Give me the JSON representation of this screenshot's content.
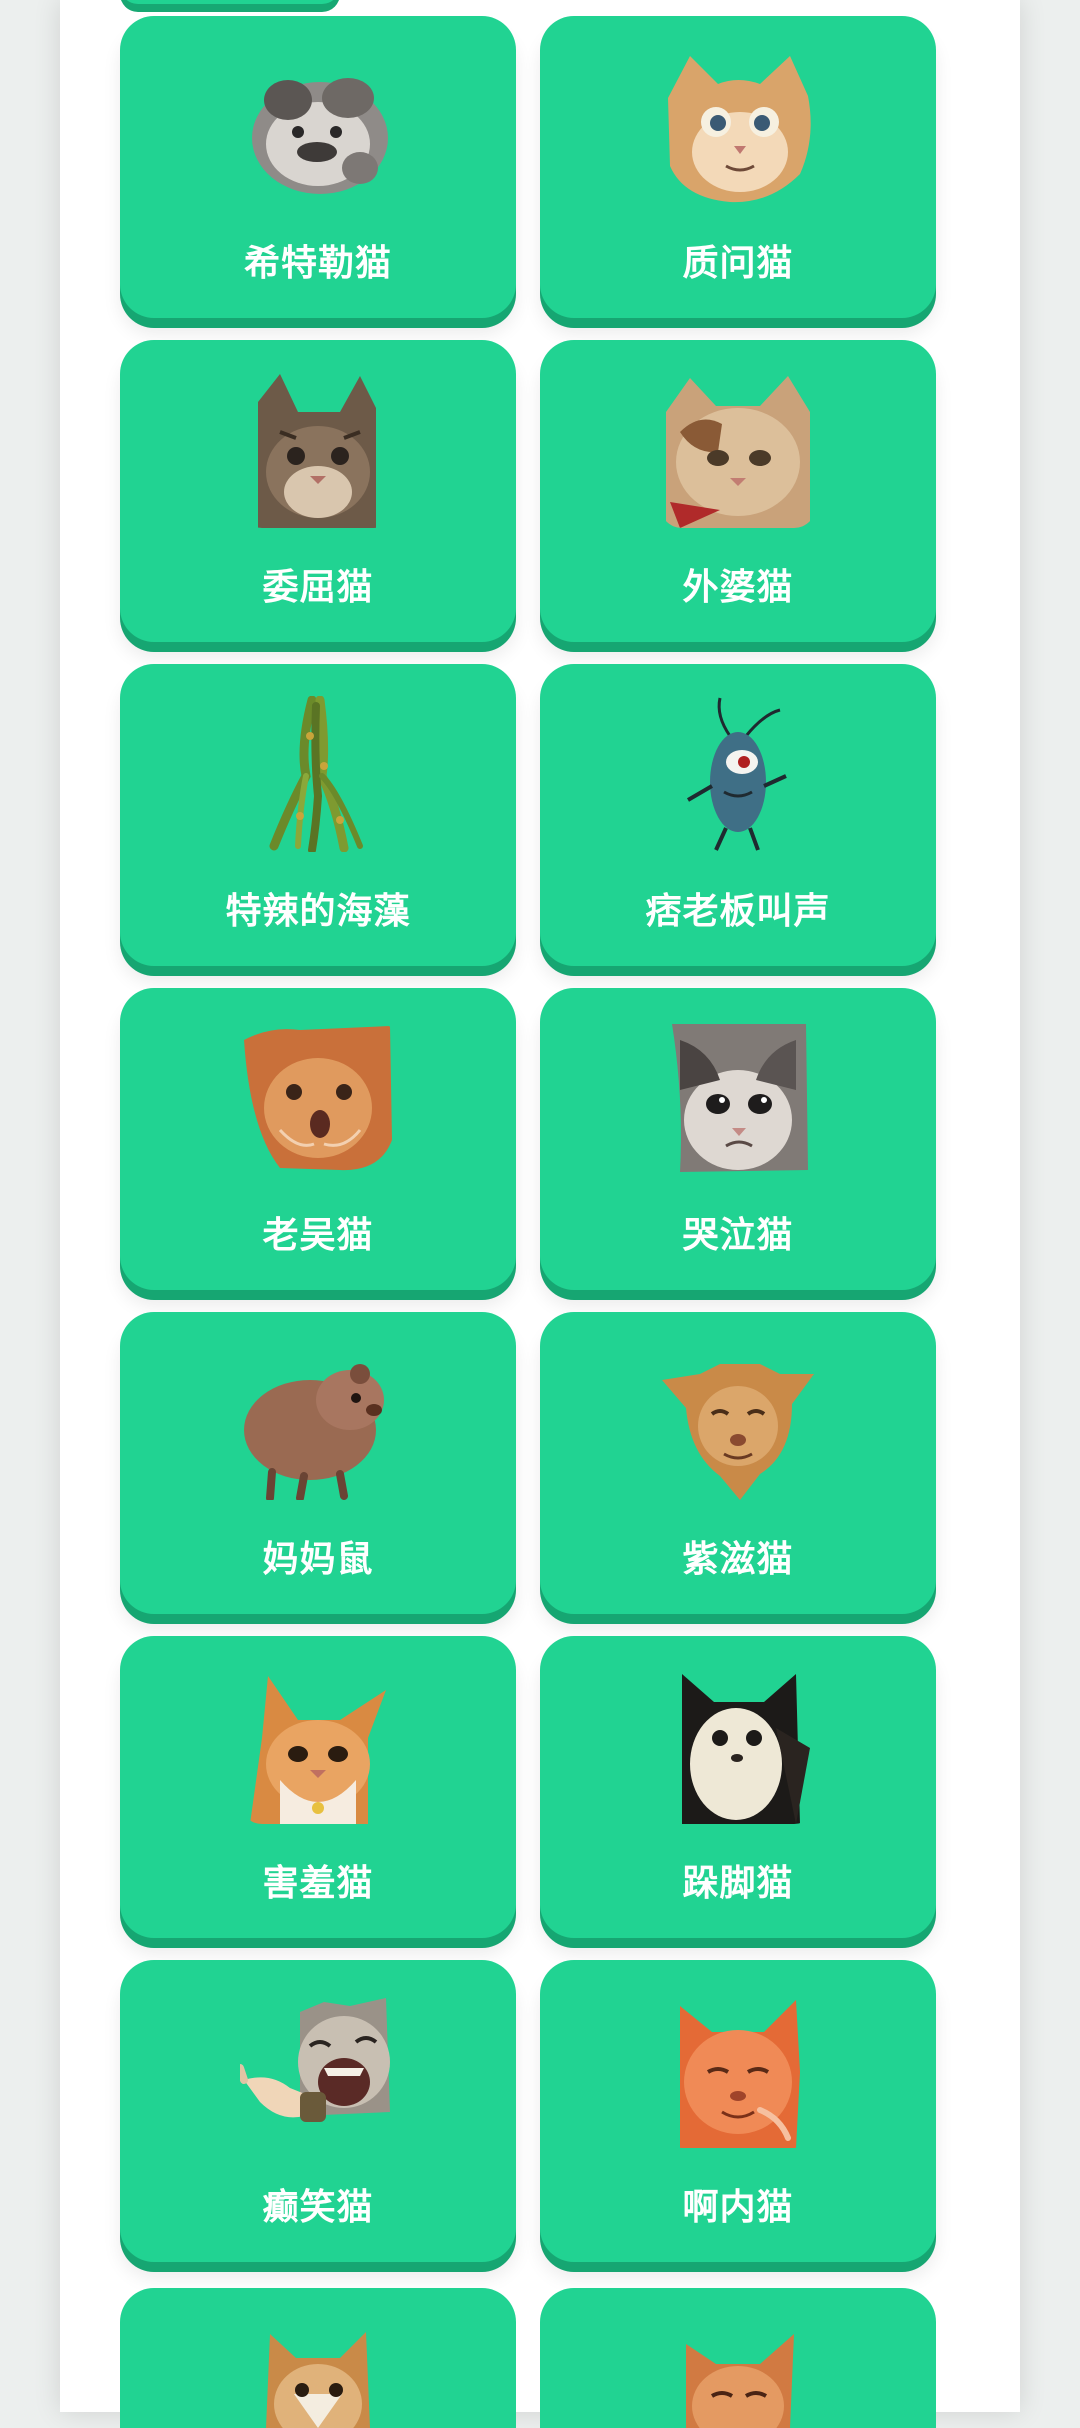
{
  "cards": [
    {
      "label": "希特勒猫",
      "icon": "grey-cat-icon"
    },
    {
      "label": "质问猫",
      "icon": "orange-cat-icon"
    },
    {
      "label": "委屈猫",
      "icon": "tabby-cat-icon"
    },
    {
      "label": "外婆猫",
      "icon": "calico-cat-icon"
    },
    {
      "label": "特辣的海藻",
      "icon": "seaweed-icon"
    },
    {
      "label": "痞老板叫声",
      "icon": "plankton-icon"
    },
    {
      "label": "老吴猫",
      "icon": "orange-cat-icon"
    },
    {
      "label": "哭泣猫",
      "icon": "crying-cat-icon"
    },
    {
      "label": "妈妈鼠",
      "icon": "hamster-icon"
    },
    {
      "label": "紫滋猫",
      "icon": "squint-cat-icon"
    },
    {
      "label": "害羞猫",
      "icon": "shy-cat-icon"
    },
    {
      "label": "跺脚猫",
      "icon": "black-white-cat-icon"
    },
    {
      "label": "癫笑猫",
      "icon": "laughing-cat-icon"
    },
    {
      "label": "啊内猫",
      "icon": "orange-cat-icon"
    }
  ],
  "colors": {
    "card": "#21d392",
    "card_shadow": "#16a672",
    "label": "#ffffff",
    "background": "#ffffff"
  }
}
